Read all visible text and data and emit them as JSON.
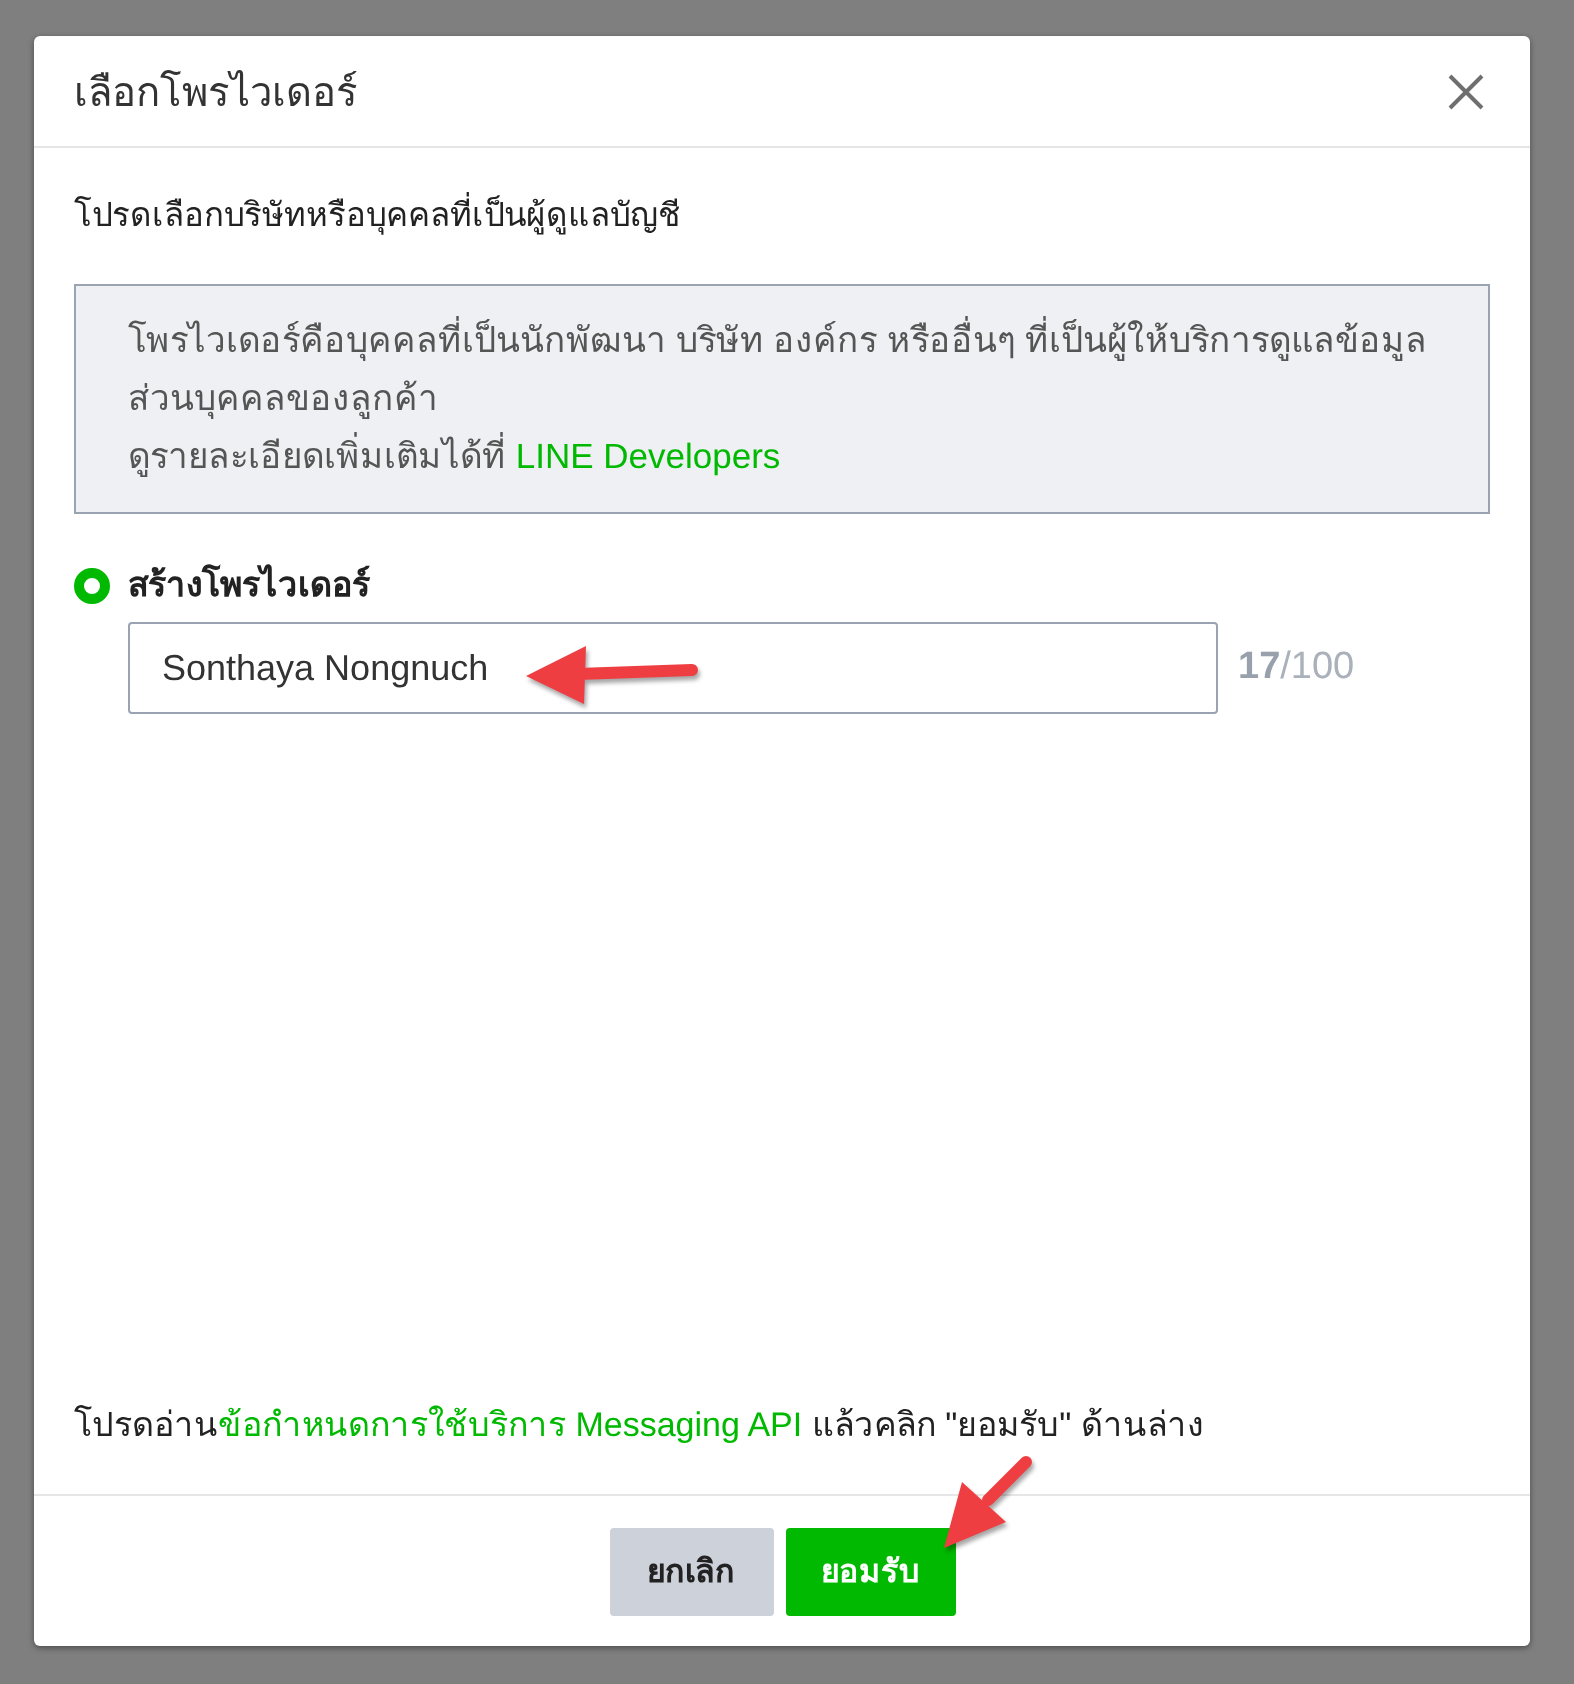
{
  "dialog": {
    "title": "เลือกโพรไวเดอร์",
    "instruction": "โปรดเลือกบริษัทหรือบุคคลที่เป็นผู้ดูแลบัญชี",
    "info": {
      "description": "โพรไวเดอร์คือบุคคลที่เป็นนักพัฒนา บริษัท องค์กร หรืออื่นๆ ที่เป็นผู้ให้บริการดูแลข้อมูลส่วนบุคคลของลูกค้า",
      "details_prefix": "ดูรายละเอียดเพิ่มเติมได้ที่ ",
      "details_link": "LINE Developers"
    },
    "options": [
      {
        "kind": "radio",
        "label": "สร้างโพรไวเดอร์",
        "selected": true,
        "value": "Sonthaya Nongnuch",
        "counter": "**17**/100"
      }
    ],
    "terms": {
      "before": "โปรดอ่าน",
      "link": "ข้อกำหนดการใช้บริการ Messaging API",
      "after": " แล้วคลิก \"ยอมรับ\" ด้านล่าง"
    },
    "buttons": [
      {
        "kind": "secondary",
        "label": "ยกเลิก"
      },
      {
        "kind": "primary",
        "label": "ยอมรับ"
      }
    ]
  }
}
